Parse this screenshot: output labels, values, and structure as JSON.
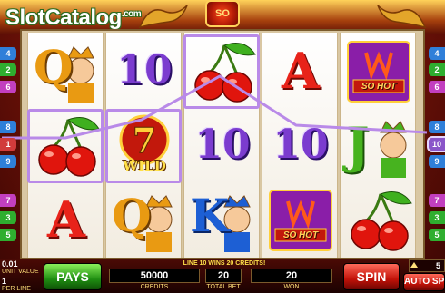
{
  "watermark": {
    "name": "SlotCatalog",
    "suffix": ".com"
  },
  "game_logo": {
    "text": "SO HOT"
  },
  "reels": [
    [
      "Q",
      "cherries",
      "A"
    ],
    [
      "10",
      "wild",
      "Q"
    ],
    [
      "cherries",
      "10",
      "K"
    ],
    [
      "A",
      "10",
      "sohot"
    ],
    [
      "sohot",
      "J",
      "cherries"
    ]
  ],
  "wild_text": "WILD",
  "sohot_text": "SO HOT",
  "left_lines": [
    "4",
    "2",
    "6",
    "8",
    "1",
    "9",
    "7",
    "3",
    "5"
  ],
  "right_lines": [
    "4",
    "2",
    "6",
    "8",
    "10",
    "9",
    "7",
    "3",
    "5"
  ],
  "left_line_colors": [
    "#2f7fd9",
    "#2fae2f",
    "#c23fbf",
    "#2f7fd9",
    "#d13b3b",
    "#2f7fd9",
    "#c23fbf",
    "#2fae2f",
    "#2fae2f"
  ],
  "right_line_colors": [
    "#2f7fd9",
    "#2fae2f",
    "#c23fbf",
    "#2f7fd9",
    "#8a55c9",
    "#2f7fd9",
    "#c23fbf",
    "#2fae2f",
    "#2fae2f"
  ],
  "active_line": "10",
  "win_message": "LINE 10 WINS 20 CREDITS!",
  "bottom": {
    "coin_value": "0.01",
    "coin_label": "UNIT VALUE",
    "lines_value": "1",
    "lines_label": "PER LINE",
    "pays_label": "PAYS",
    "credits_value": "50000",
    "credits_label": "CREDITS",
    "total_bet_value": "20",
    "total_bet_label": "TOTAL BET",
    "won_value": "20",
    "won_label": "WON",
    "spin_label": "SPIN",
    "autospin_count": "5",
    "autospin_label": "AUTO SPIN"
  },
  "colors": {
    "win_line": "#b98ae8",
    "pays_button": "#1f8e12",
    "spin_button": "#c21208",
    "accent_gold": "#ffe04a"
  }
}
